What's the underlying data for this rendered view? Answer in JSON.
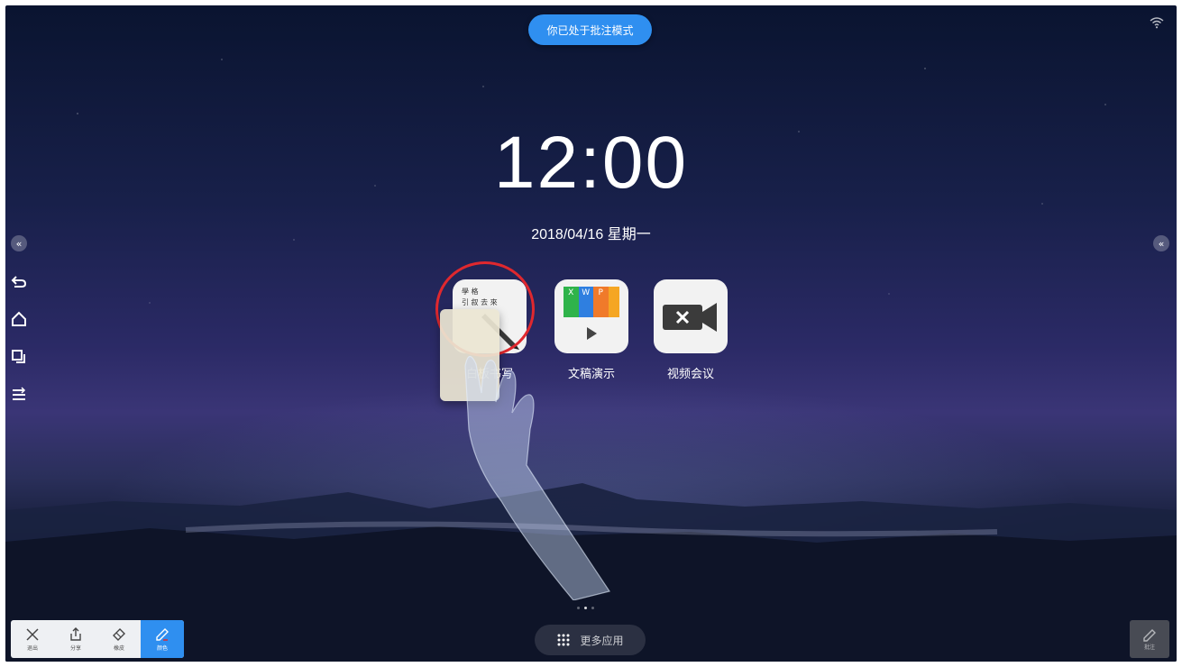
{
  "status": {
    "annotation_mode": "你已处于批注模式"
  },
  "clock": {
    "time": "12:00",
    "date": "2018/04/16  星期一"
  },
  "apps": [
    {
      "label": "白板书写",
      "icon": "whiteboard-icon"
    },
    {
      "label": "文稿演示",
      "icon": "slides-icon"
    },
    {
      "label": "视频会议",
      "icon": "video-conference-icon"
    }
  ],
  "whiteboard_preview_text": [
    "學 格",
    "引 叙 去 來"
  ],
  "slides_tile_letters": [
    "X",
    "W",
    "P"
  ],
  "page_indicator": {
    "total": 3,
    "current": 1
  },
  "more_apps": {
    "label": "更多应用"
  },
  "toolbar": {
    "exit_label": "退出",
    "share_label": "分享",
    "eraser_label": "橡皮",
    "color_label": "颜色"
  },
  "pen_float_label": "批注",
  "colors": {
    "accent": "#2f8ff0",
    "highlight_circle": "#e0282e"
  }
}
